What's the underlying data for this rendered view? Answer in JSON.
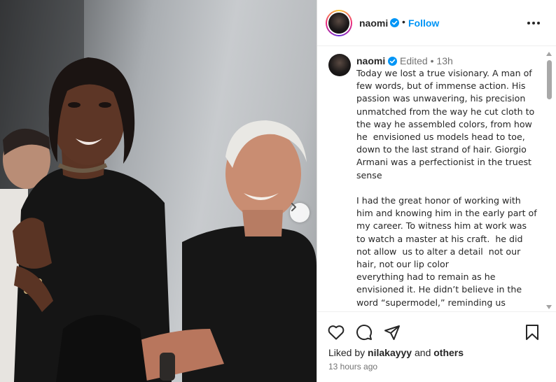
{
  "post": {
    "username": "naomi",
    "follow_label": "Follow",
    "separator_dot": "•",
    "edited_label": "Edited",
    "time_short": "13h",
    "caption_paragraphs": [
      "Today we lost a true visionary. A man of few words, but of immense action. His passion was unwavering, his precision unmatched from the way he cut cloth to the way he assembled colors, from how he  envisioned us models head to toe, down to the last strand of hair. Giorgio Armani was a perfectionist in the truest sense",
      "I had the great honor of working with him and knowing him in the early part of my career. To witness him at work was to watch a master at his craft.  he did not allow  us to alter a detail  not our hair, not our lip color\neverything had to remain as he envisioned it. He didn’t believe in the word “supermodel,” reminding us instead that we were simply numbers"
    ],
    "liked_by_prefix": "Liked by",
    "liked_by_user": "nilakayyy",
    "liked_by_and": "and",
    "liked_by_others": "others",
    "time_ago": "13 hours ago"
  },
  "icons": {
    "verified": "verified-badge-icon",
    "more": "more-options-icon",
    "like": "heart-icon",
    "comment": "comment-icon",
    "share": "paper-plane-icon",
    "save": "bookmark-icon",
    "carousel_next": "chevron-right-icon"
  },
  "colors": {
    "link_blue": "#0095f6",
    "verified_blue": "#0095f6",
    "text_primary": "#262626",
    "text_muted": "#737373"
  }
}
